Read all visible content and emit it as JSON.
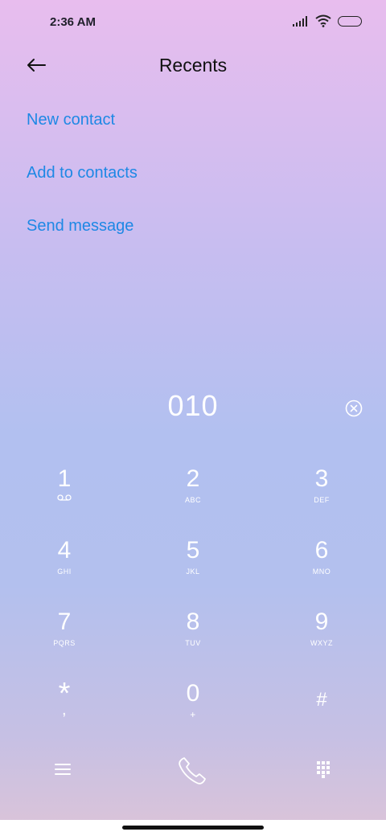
{
  "status_bar": {
    "time": "2:36 AM"
  },
  "header": {
    "title": "Recents"
  },
  "menu": {
    "items": [
      "New contact",
      "Add to contacts",
      "Send message"
    ]
  },
  "dialer": {
    "number": "010",
    "keys": [
      {
        "digit": "1",
        "letters": ""
      },
      {
        "digit": "2",
        "letters": "ABC"
      },
      {
        "digit": "3",
        "letters": "DEF"
      },
      {
        "digit": "4",
        "letters": "GHI"
      },
      {
        "digit": "5",
        "letters": "JKL"
      },
      {
        "digit": "6",
        "letters": "MNO"
      },
      {
        "digit": "7",
        "letters": "PQRS"
      },
      {
        "digit": "8",
        "letters": "TUV"
      },
      {
        "digit": "9",
        "letters": "WXYZ"
      },
      {
        "digit": "*",
        "letters": ","
      },
      {
        "digit": "0",
        "letters": "+"
      },
      {
        "digit": "#",
        "letters": ""
      }
    ]
  },
  "colors": {
    "accent": "#1e88e5",
    "key_text": "#ffffff"
  },
  "icons": {
    "back": "arrow-left-icon",
    "clear": "clear-circle-icon",
    "voicemail": "voicemail-icon",
    "menu": "menu-icon",
    "call": "phone-icon",
    "dialpad": "dialpad-icon"
  }
}
